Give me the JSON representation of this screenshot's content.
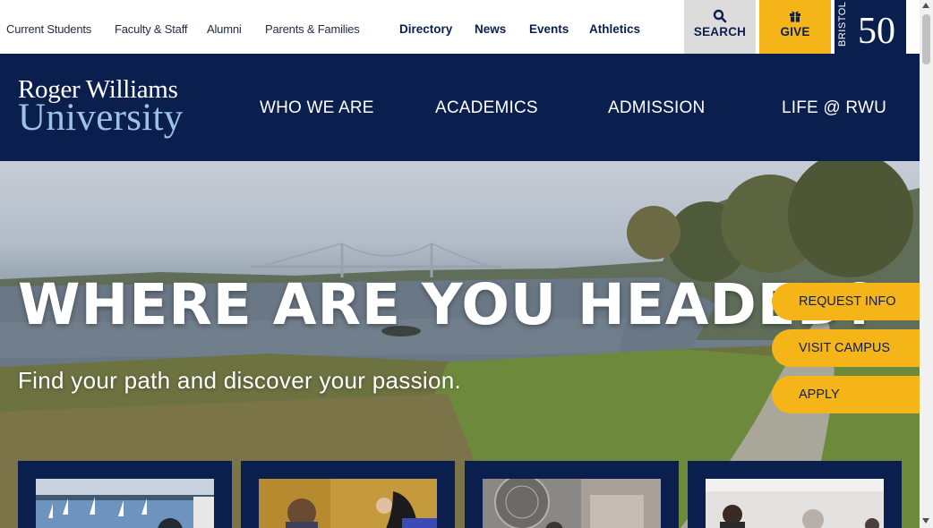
{
  "utility_nav": {
    "links": [
      "Current Students",
      "Faculty & Staff",
      "Alumni",
      "Parents & Families"
    ],
    "bold_links": [
      "Directory",
      "News",
      "Events",
      "Athletics"
    ],
    "search_label": "SEARCH",
    "give_label": "GIVE",
    "bristol_text": "BRISTOL",
    "anniversary_number": "50"
  },
  "logo": {
    "line1": "Roger Williams",
    "line2": "University"
  },
  "main_nav": [
    "WHO WE ARE",
    "ACADEMICS",
    "ADMISSION",
    "LIFE @ RWU"
  ],
  "hero": {
    "title": "WHERE ARE YOU HEADED?",
    "subtitle": "Find your path and discover your passion."
  },
  "cta_buttons": [
    "REQUEST INFO",
    "VISIT CAMPUS",
    "APPLY"
  ],
  "colors": {
    "navy": "#0b1f4f",
    "gold": "#f5b519",
    "light_blue": "#9cc3e6",
    "gray_button": "#dcdcdc"
  },
  "icons": {
    "search": "search-icon",
    "give": "gift-icon"
  }
}
